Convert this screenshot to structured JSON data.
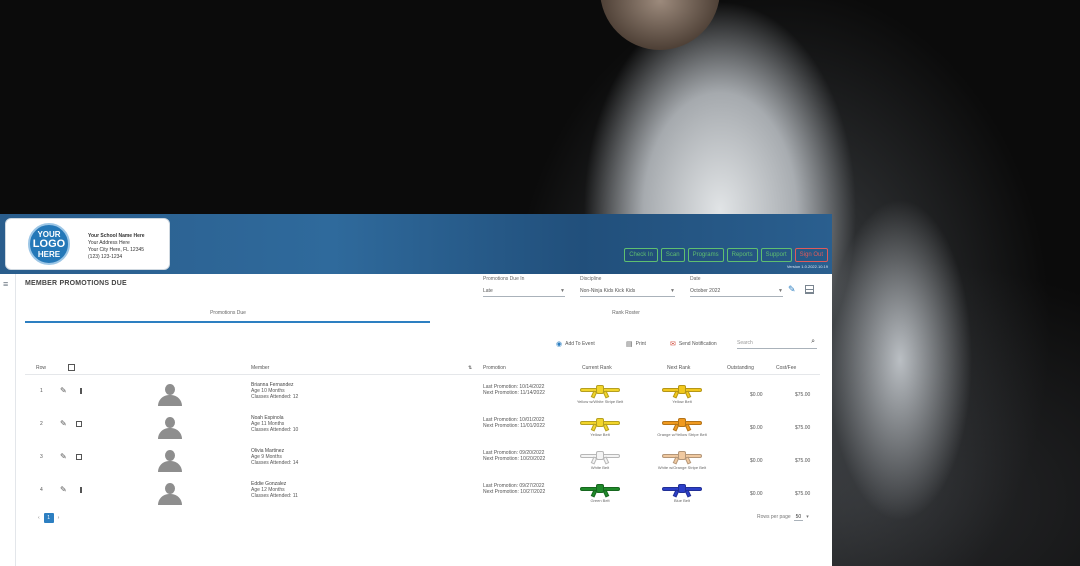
{
  "school": {
    "logo_line1": "YOUR",
    "logo_line2": "LOGO",
    "logo_line3": "HERE",
    "name": "Your School Name Here",
    "address": "Your Address Here",
    "city": "Your City Here, FL 12345",
    "phone": "(123) 123-1234"
  },
  "header_buttons": [
    "Check In",
    "Scan",
    "Programs",
    "Reports",
    "Support",
    "Sign Out"
  ],
  "version": "Version 1.0.2022.10.19",
  "page_title": "MEMBER PROMOTIONS DUE",
  "filters": [
    {
      "label": "Promotions Due In",
      "value": "Late"
    },
    {
      "label": "Discipline",
      "value": "Non-Ninja Kids Kick Kids"
    },
    {
      "label": "Date",
      "value": "October 2022"
    }
  ],
  "tabs": [
    "Promotions Due",
    "Rank Roster"
  ],
  "toolbar": {
    "add_label": "Add To Event",
    "print_label": "Print",
    "send_label": "Send Notification",
    "search_placeholder": "Search"
  },
  "columns": {
    "row": "Row",
    "member": "Member",
    "promotion": "Promotion",
    "current_rank": "Current Rank",
    "next_rank": "Next Rank",
    "outstanding": "Outstanding",
    "cost": "Cost/Fee"
  },
  "rows": [
    {
      "num": "1",
      "name": "Brianna Fernandez",
      "age": "Age 10 Months",
      "attended": "Classes Attended: 12",
      "promo1": "Last Promotion: 10/14/2022",
      "promo2": "Next Promotion: 11/14/2022",
      "current_label": "Yellow w/White Stripe Belt",
      "current_color": "#f2d52a",
      "next_label": "Yellow Belt",
      "next_color": "#f2c81e",
      "outstanding": "$0.00",
      "cost": "$75.00"
    },
    {
      "num": "2",
      "name": "Noah Espinola",
      "age": "Age 11 Months",
      "attended": "Classes Attended: 10",
      "promo1": "Last Promotion: 10/01/2022",
      "promo2": "Next Promotion: 11/01/2022",
      "current_label": "Yellow Belt",
      "current_color": "#f2d52a",
      "next_label": "Orange w/Yellow Stripe Belt",
      "next_color": "#f09a20",
      "outstanding": "$0.00",
      "cost": "$75.00"
    },
    {
      "num": "3",
      "name": "Olivia Martinez",
      "age": "Age 9 Months",
      "attended": "Classes Attended: 14",
      "promo1": "Last Promotion: 09/20/2022",
      "promo2": "Next Promotion: 10/20/2022",
      "current_label": "White Belt",
      "current_color": "#f4f4f4",
      "next_label": "White w/Orange Stripe Belt",
      "next_color": "#f0c9a0",
      "outstanding": "$0.00",
      "cost": "$75.00"
    },
    {
      "num": "4",
      "name": "Eddie Gonzalez",
      "age": "Age 12 Months",
      "attended": "Classes Attended: 11",
      "promo1": "Last Promotion: 09/27/2022",
      "promo2": "Next Promotion: 10/27/2022",
      "current_label": "Green Belt",
      "current_color": "#1f8a2a",
      "next_label": "Blue Belt",
      "next_color": "#2c3fc8",
      "outstanding": "$0.00",
      "cost": "$75.00"
    }
  ],
  "pager": {
    "prev": "‹",
    "current": "1",
    "next": "›"
  },
  "rows_per_page": {
    "label": "Rows per page",
    "value": "50"
  }
}
